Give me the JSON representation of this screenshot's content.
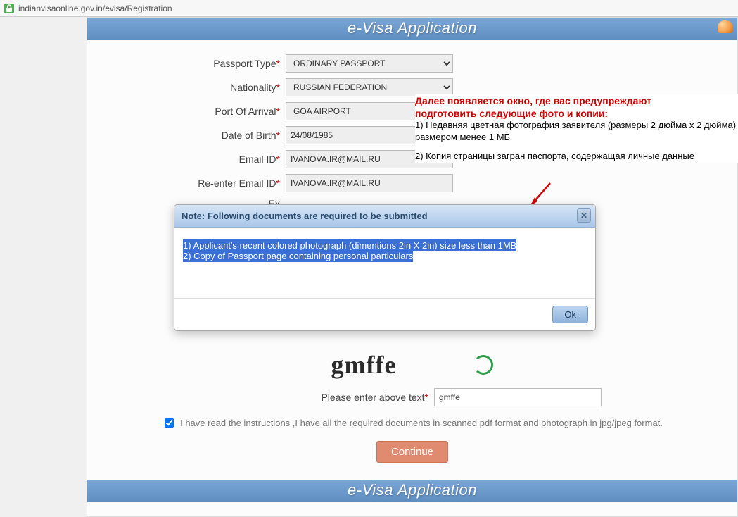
{
  "address_bar": {
    "url": "indianvisaonline.gov.in/evisa/Registration"
  },
  "banner_title": "e-Visa Application",
  "form": {
    "passport_type": {
      "label": "Passport Type",
      "value": "ORDINARY PASSPORT"
    },
    "nationality": {
      "label": "Nationality",
      "value": "RUSSIAN FEDERATION"
    },
    "port": {
      "label": "Port Of Arrival",
      "value": "GOA AIRPORT"
    },
    "dob": {
      "label": "Date of Birth",
      "value": "24/08/1985"
    },
    "email": {
      "label": "Email ID",
      "value": "IVANOVA.IR@MAIL.RU"
    },
    "email2": {
      "label": "Re-enter Email ID",
      "value": "IVANOVA.IR@MAIL.RU"
    },
    "exp": {
      "label": "Ex"
    }
  },
  "captcha": {
    "image_text": "gmffe",
    "enter_label": "Please enter above text",
    "value": "gmffe"
  },
  "agree": {
    "checked": true,
    "text": "I have read the instructions ,I have all the required documents in scanned pdf format and photograph in jpg/jpeg format."
  },
  "continue_label": "Continue",
  "annotation": {
    "line1": "Далее появляется окно, где вас предупреждают",
    "line2": "подготовить следующие фото и копии:",
    "item1": "1) Недавняя цветная фотография заявителя (размеры 2 дюйма х 2 дюйма) размером менее 1 МБ",
    "item2": "2) Копия страницы загран паспорта, содержащая личные данные"
  },
  "modal": {
    "title": "Note: Following documents are required to be submitted",
    "line1": "1) Applicant's recent colored photograph (dimentions 2in X 2in) size less than 1MB",
    "line2": "2) Copy of Passport page containing personal particulars",
    "ok": "Ok"
  }
}
